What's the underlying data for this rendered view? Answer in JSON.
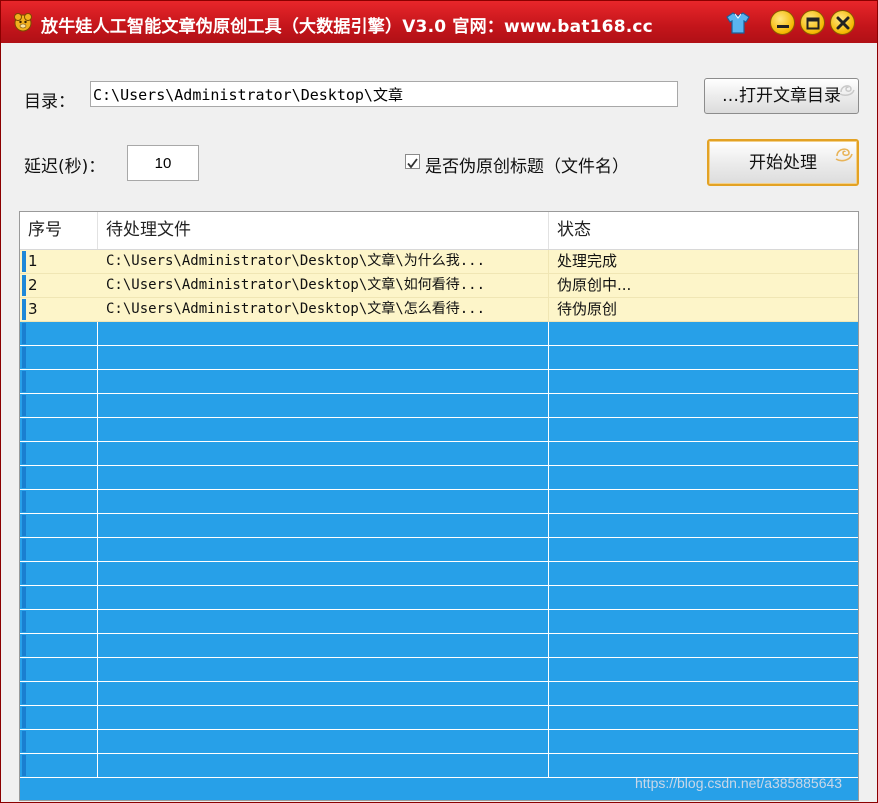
{
  "window": {
    "title": "放牛娃人工智能文章伪原创工具（大数据引擎）V3.0  官网：www.bat168.cc",
    "controls": [
      "skin-icon",
      "minimize-icon",
      "maximize-icon",
      "close-icon"
    ]
  },
  "form": {
    "dir_label": "目录：",
    "dir_value": "C:\\Users\\Administrator\\Desktop\\文章",
    "open_button": "…打开文章目录",
    "delay_label": "延迟(秒)：",
    "delay_value": "10",
    "checkbox_label": "是否伪原创标题（文件名）",
    "checkbox_checked": true,
    "start_button": "开始处理"
  },
  "list": {
    "columns": [
      "序号",
      "待处理文件",
      "状态"
    ],
    "rows": [
      {
        "num": "1",
        "file": "C:\\Users\\Administrator\\Desktop\\文章\\为什么我...",
        "status": "处理完成"
      },
      {
        "num": "2",
        "file": "C:\\Users\\Administrator\\Desktop\\文章\\如何看待...",
        "status": "伪原创中..."
      },
      {
        "num": "3",
        "file": "C:\\Users\\Administrator\\Desktop\\文章\\怎么看待...",
        "status": "待伪原创"
      }
    ]
  },
  "watermark": "https://blog.csdn.net/a385885643",
  "colors": {
    "title_bar": "#c4151b",
    "list_background": "#27a0e8",
    "row_highlight": "#fdf5c9",
    "start_button_border": "#e3a224"
  }
}
